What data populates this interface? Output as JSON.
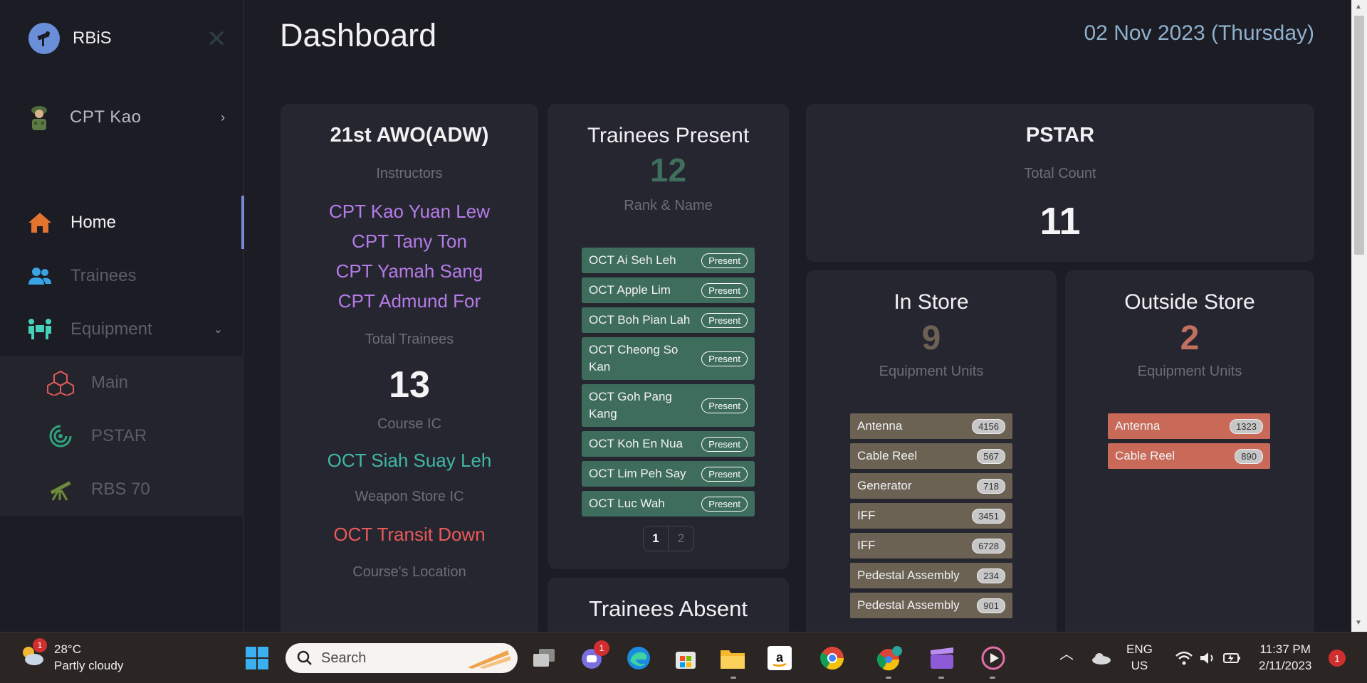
{
  "sidebar": {
    "brand": "RBiS",
    "user": "CPT Kao",
    "items": [
      {
        "label": "Home"
      },
      {
        "label": "Trainees"
      },
      {
        "label": "Equipment"
      }
    ],
    "subitems": [
      {
        "label": "Main"
      },
      {
        "label": "PSTAR"
      },
      {
        "label": "RBS 70"
      }
    ]
  },
  "header": {
    "title": "Dashboard",
    "date": "02 Nov 2023 (Thursday)"
  },
  "course_card": {
    "title": "21st AWO(ADW)",
    "instructors_label": "Instructors",
    "instructors": [
      "CPT Kao Yuan Lew",
      "CPT Tany Ton",
      "CPT Yamah Sang",
      "CPT Admund For"
    ],
    "total_trainees_label": "Total Trainees",
    "total_trainees": "13",
    "course_ic_label": "Course IC",
    "course_ic": "OCT Siah Suay Leh",
    "weapon_store_ic_label": "Weapon Store IC",
    "weapon_store_ic": "OCT Transit Down",
    "location_label": "Course's Location"
  },
  "present_card": {
    "title": "Trainees Present",
    "count": "12",
    "subtitle": "Rank & Name",
    "badge": "Present",
    "trainees": [
      "OCT Ai Seh Leh",
      "OCT Apple Lim",
      "OCT Boh Pian Lah",
      "OCT Cheong So Kan",
      "OCT Goh Pang Kang",
      "OCT Koh En Nua",
      "OCT Lim Peh Say",
      "OCT Luc Wah"
    ],
    "pages": [
      "1",
      "2"
    ]
  },
  "absent_card": {
    "title": "Trainees Absent"
  },
  "pstar_card": {
    "title": "PSTAR",
    "label": "Total Count",
    "count": "11"
  },
  "in_store": {
    "title": "In Store",
    "count": "9",
    "label": "Equipment Units",
    "items": [
      {
        "name": "Antenna",
        "id": "4156"
      },
      {
        "name": "Cable Reel",
        "id": "567"
      },
      {
        "name": "Generator",
        "id": "718"
      },
      {
        "name": "IFF",
        "id": "3451"
      },
      {
        "name": "IFF",
        "id": "6728"
      },
      {
        "name": "Pedestal Assembly",
        "id": "234"
      },
      {
        "name": "Pedestal Assembly",
        "id": "901"
      }
    ]
  },
  "outside_store": {
    "title": "Outside Store",
    "count": "2",
    "label": "Equipment Units",
    "items": [
      {
        "name": "Antenna",
        "id": "1323"
      },
      {
        "name": "Cable Reel",
        "id": "890"
      }
    ]
  },
  "taskbar": {
    "temp": "28°C",
    "weather": "Partly cloudy",
    "weather_badge": "1",
    "search_placeholder": "Search",
    "teams_badge": "1",
    "lang": "ENG",
    "region": "US",
    "time": "11:37 PM",
    "date": "2/11/2023",
    "notifications": "1"
  }
}
